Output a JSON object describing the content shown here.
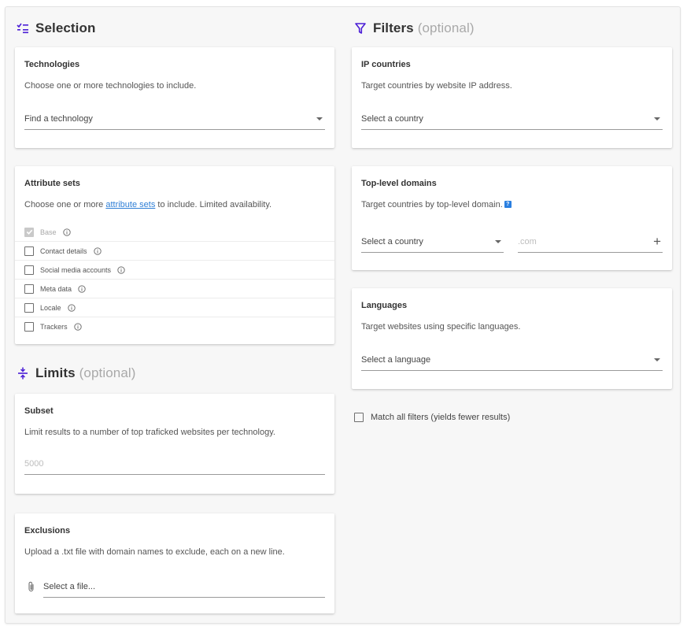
{
  "selection": {
    "title": "Selection",
    "technologies": {
      "title": "Technologies",
      "description": "Choose one or more technologies to include.",
      "select_label": "Find a technology"
    },
    "attribute_sets": {
      "title": "Attribute sets",
      "desc_before": "Choose one or more ",
      "desc_link": "attribute sets",
      "desc_after": " to include. Limited availability.",
      "items": [
        {
          "label": "Base",
          "checked": true,
          "disabled": true
        },
        {
          "label": "Contact details",
          "checked": false,
          "disabled": false
        },
        {
          "label": "Social media accounts",
          "checked": false,
          "disabled": false
        },
        {
          "label": "Meta data",
          "checked": false,
          "disabled": false
        },
        {
          "label": "Locale",
          "checked": false,
          "disabled": false
        },
        {
          "label": "Trackers",
          "checked": false,
          "disabled": false
        }
      ]
    }
  },
  "limits": {
    "title": "Limits",
    "optional_label": "(optional)",
    "subset": {
      "title": "Subset",
      "description": "Limit results to a number of top traficked websites per technology.",
      "placeholder": "5000"
    },
    "exclusions": {
      "title": "Exclusions",
      "description": "Upload a .txt file with domain names to exclude, each on a new line.",
      "file_label": "Select a file..."
    }
  },
  "filters": {
    "title": "Filters",
    "optional_label": "(optional)",
    "ip_countries": {
      "title": "IP countries",
      "description": "Target countries by website IP address.",
      "select_label": "Select a country"
    },
    "tld": {
      "title": "Top-level domains",
      "description": "Target countries by top-level domain.",
      "help_badge": "?",
      "select_label": "Select a country",
      "input_placeholder": ".com",
      "add_symbol": "+"
    },
    "languages": {
      "title": "Languages",
      "description": "Target websites using specific languages.",
      "select_label": "Select a language"
    },
    "match_all_label": "Match all filters (yields fewer results)"
  },
  "colors": {
    "accent": "#4b1ed6",
    "link": "#2f7fd6",
    "help_badge": "#2a7fe0"
  }
}
